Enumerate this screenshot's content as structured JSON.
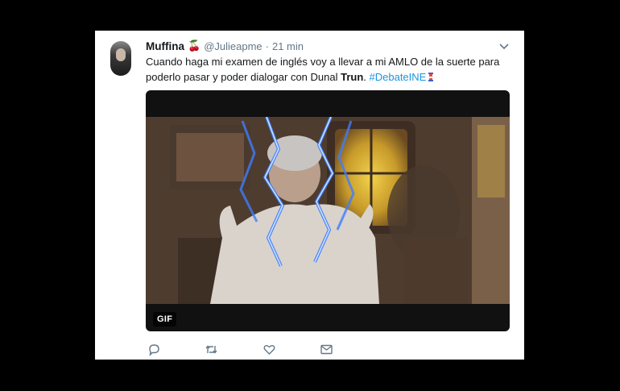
{
  "tweet": {
    "display_name": "Muffina",
    "name_emoji": "🍒",
    "handle": "@Julieapme",
    "separator": "·",
    "time": "21 min",
    "text_part1": "Cuando haga mi examen de inglés voy a llevar a mi AMLO de la suerte para poderlo pasar y poder dialogar con Dunal ",
    "text_bold": "Trun",
    "text_part2": ". ",
    "hashtag": "#DebateINE"
  },
  "media": {
    "badge": "GIF"
  },
  "actions": {
    "reply_icon": "reply-icon",
    "retweet_icon": "retweet-icon",
    "like_icon": "heart-icon",
    "dm_icon": "envelope-icon"
  },
  "colors": {
    "background": "#000000",
    "card": "#ffffff",
    "text": "#14171a",
    "muted": "#657786",
    "hashtag": "#1b95e0"
  }
}
